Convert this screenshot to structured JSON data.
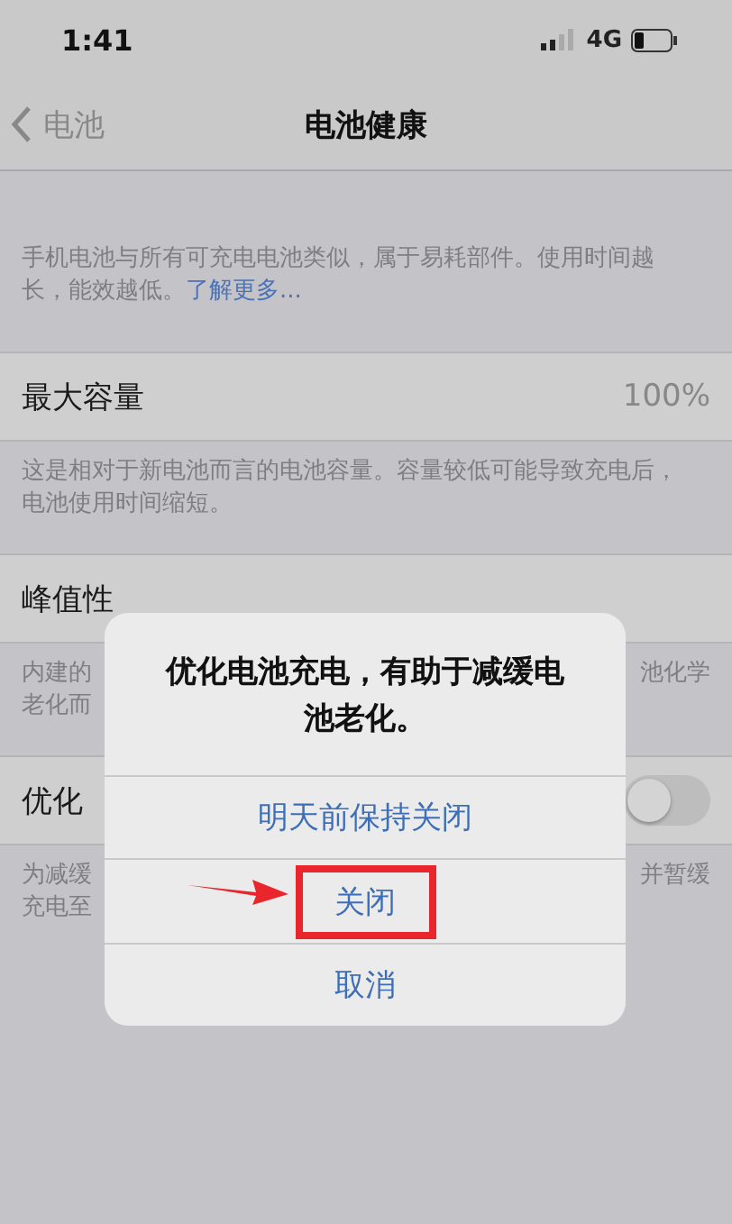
{
  "status_bar": {
    "time": "1:41",
    "network": "4G"
  },
  "nav": {
    "back": "电池",
    "title": "电池健康"
  },
  "intro": {
    "text": "手机电池与所有可充电电池类似，属于易耗部件。使用时间越长，能效越低。",
    "link": "了解更多..."
  },
  "sections": [
    {
      "kind": "value",
      "label": "最大容量",
      "value": "100%",
      "footer": "这是相对于新电池而言的电池容量。容量较低可能导致充电后，电池使用时间缩短。"
    },
    {
      "kind": "partial",
      "label": "峰值性",
      "footer_lines": [
        {
          "left": "内建的",
          "right": "池化学"
        },
        {
          "left": "老化而"
        }
      ]
    },
    {
      "kind": "toggle",
      "label": "优化",
      "on": false,
      "footer_lines": [
        {
          "left": "为减缓",
          "right": "并暂缓"
        },
        {
          "left": "充电至"
        }
      ]
    }
  ],
  "dialog": {
    "title": "优化电池充电，有助于减缓电池老化。",
    "buttons": [
      {
        "label": "明天前保持关闭",
        "highlighted": false
      },
      {
        "label": "关闭",
        "highlighted": true
      },
      {
        "label": "取消",
        "highlighted": false
      }
    ]
  }
}
